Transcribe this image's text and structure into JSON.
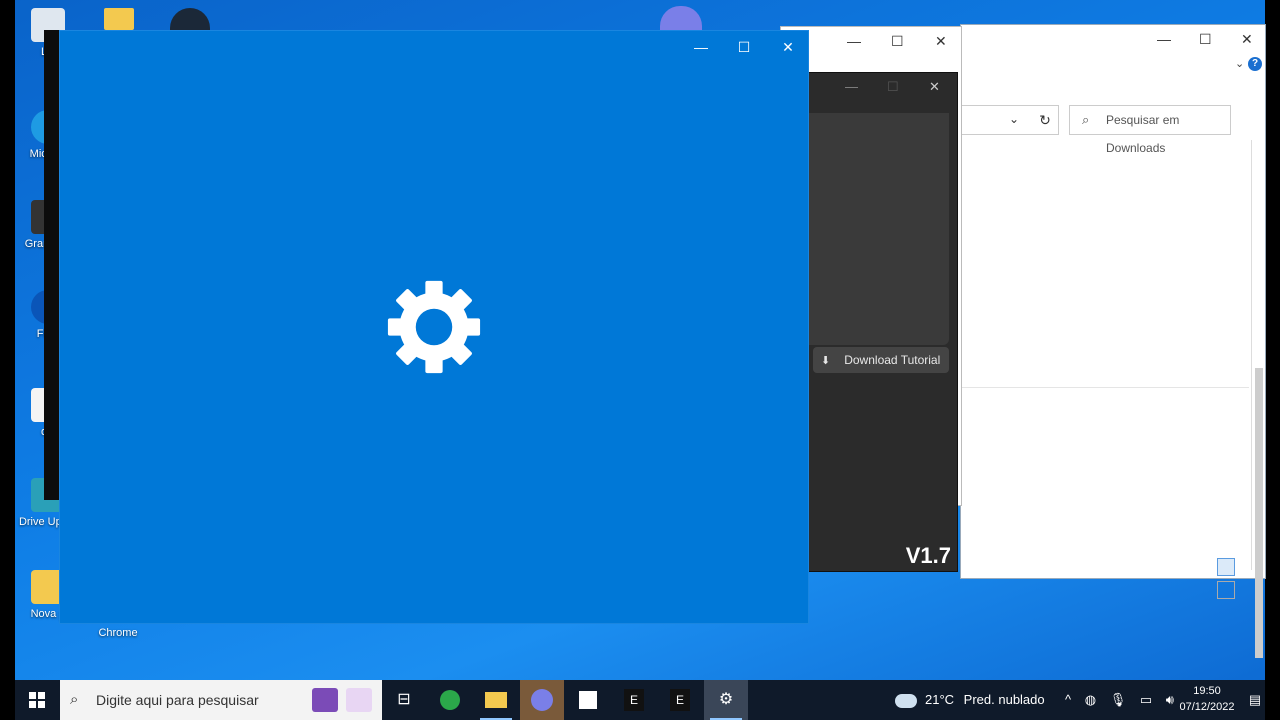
{
  "desktop": {
    "icons": [
      {
        "label": "Lix"
      },
      {
        "label": "Micr Ec"
      },
      {
        "label": "Grand Au"
      },
      {
        "label": "Free"
      },
      {
        "label": "oC"
      },
      {
        "label": "Drive Updat"
      },
      {
        "label": "Nova p"
      },
      {
        "label": "Chrome"
      }
    ]
  },
  "explorer": {
    "search_placeholder": "Pesquisar em Downloads"
  },
  "dark_app": {
    "download_label": "Download Tutorial",
    "version": "V1.7"
  },
  "taskbar": {
    "search_placeholder": "Digite aqui para pesquisar",
    "weather_temp": "21°C",
    "weather_desc": "Pred. nublado",
    "time": "19:50",
    "date": "07/12/2022"
  },
  "colors": {
    "splash_bg": "#0078d7",
    "taskbar_bg": "#0f1a2a"
  }
}
